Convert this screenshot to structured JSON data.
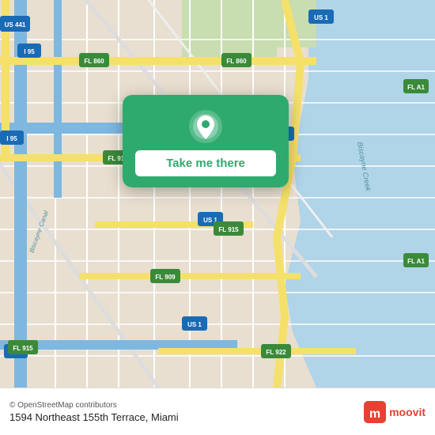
{
  "map": {
    "background_color": "#e8dfd0",
    "water_color": "#b0d4e8",
    "green_color": "#c8ddb0",
    "road_color": "#ffffff",
    "highway_color": "#f5e06a",
    "interstate_color": "#7eb8e0"
  },
  "card": {
    "background_color": "#2eaa6e",
    "button_label": "Take me there",
    "pin_icon": "location-pin"
  },
  "footer": {
    "copyright": "© OpenStreetMap contributors",
    "address": "1594 Northeast 155th Terrace, Miami",
    "logo_text": "moovit"
  },
  "labels": {
    "us1": "US 1",
    "us441": "US 441",
    "fl860": "FL 860",
    "fl915": "FL 915",
    "fl909": "FL 909",
    "fl922": "FL 922",
    "i95": "I 95",
    "fl1a": "FL A1",
    "biscayne_creek": "Biscayne Creek"
  }
}
